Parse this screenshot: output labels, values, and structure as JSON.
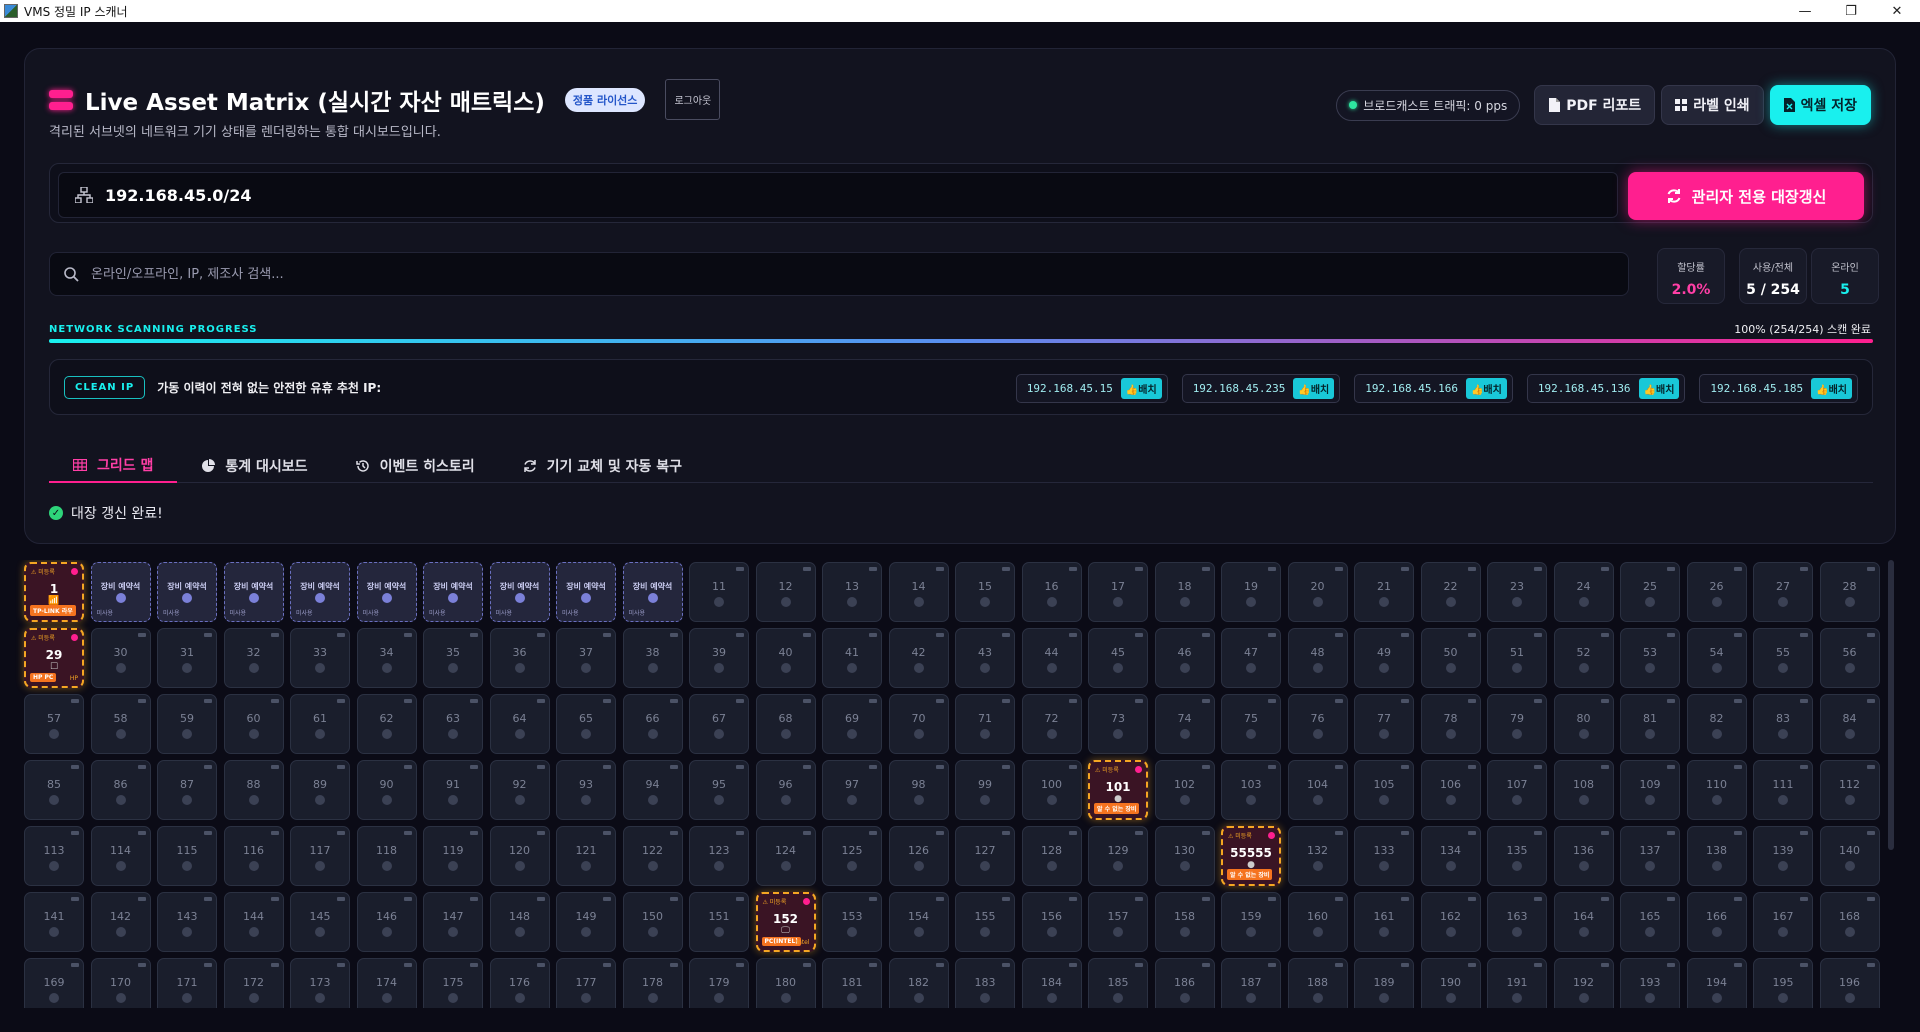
{
  "window": {
    "title": "VMS 정밀 IP 스캐너",
    "min": "—",
    "max": "❐",
    "close": "✕"
  },
  "header": {
    "title": "Live Asset Matrix (실시간 자산 매트릭스)",
    "license_badge": "정품 라이선스",
    "logout": "로그아웃",
    "subtitle": "격리된 서브넷의 네트워크 기기 상태를 렌더링하는 통합 대시보드입니다."
  },
  "actions": {
    "traffic": "브로드캐스트 트래픽: 0 pps",
    "pdf": "PDF 리포트",
    "label_print": "라벨 인쇄",
    "excel": "엑셀 저장"
  },
  "subnet": {
    "value": "192.168.45.0/24",
    "refresh_label": "관리자 전용 대장갱신"
  },
  "search": {
    "placeholder": "온라인/오프라인, IP, 제조사 검색..."
  },
  "stats": [
    {
      "label": "할당률",
      "value": "2.0%",
      "color": "#ff3fa6"
    },
    {
      "label": "사용/전체",
      "value": "5 / 254",
      "color": "#ffffff"
    },
    {
      "label": "온라인",
      "value": "5",
      "color": "#19f0ee"
    }
  ],
  "progress": {
    "label": "NETWORK SCANNING PROGRESS",
    "status": "100% (254/254) 스캔 완료",
    "fraction": 1.0
  },
  "clean_ip": {
    "tag": "CLEAN IP",
    "text": "가동 이력이 전혀 없는 안전한 유휴 추천 IP:",
    "assign_label": "배치",
    "ips": [
      "192.168.45.15",
      "192.168.45.235",
      "192.168.45.166",
      "192.168.45.136",
      "192.168.45.185"
    ]
  },
  "tabs": [
    {
      "label": "그리드 맵",
      "icon": "grid-icon",
      "active": true
    },
    {
      "label": "통계 대시보드",
      "icon": "pie-chart-icon",
      "active": false
    },
    {
      "label": "이벤트 히스토리",
      "icon": "history-icon",
      "active": false
    },
    {
      "label": "기기 교체 및 자동 복구",
      "icon": "sync-icon",
      "active": false
    }
  ],
  "notice": "대장 갱신 완료!",
  "grid": {
    "reserved_label": "장비 예약석",
    "reserved_sub": "미사용",
    "warn_label": "⚠ 미등록",
    "reserved_cells": [
      2,
      3,
      4,
      5,
      6,
      7,
      8,
      9,
      10
    ],
    "alert_cells": [
      {
        "n": 1,
        "label": "1",
        "icon": "📶",
        "tag": "TP-LINK 라우",
        "vendor": ""
      },
      {
        "n": 29,
        "label": "29",
        "icon": "☐",
        "tag": "HP PC",
        "vendor": "HP"
      },
      {
        "n": 101,
        "label": "101",
        "icon": "●",
        "tag": "알 수 없는 장비",
        "vendor": ""
      },
      {
        "n": 131,
        "label": "55555",
        "icon": "●",
        "tag": "알 수 없는 장비",
        "vendor": ""
      },
      {
        "n": 152,
        "label": "152",
        "icon": "🖵",
        "tag": "PC(INTEL)",
        "vendor": "Intel"
      }
    ],
    "visible_count": 196
  }
}
